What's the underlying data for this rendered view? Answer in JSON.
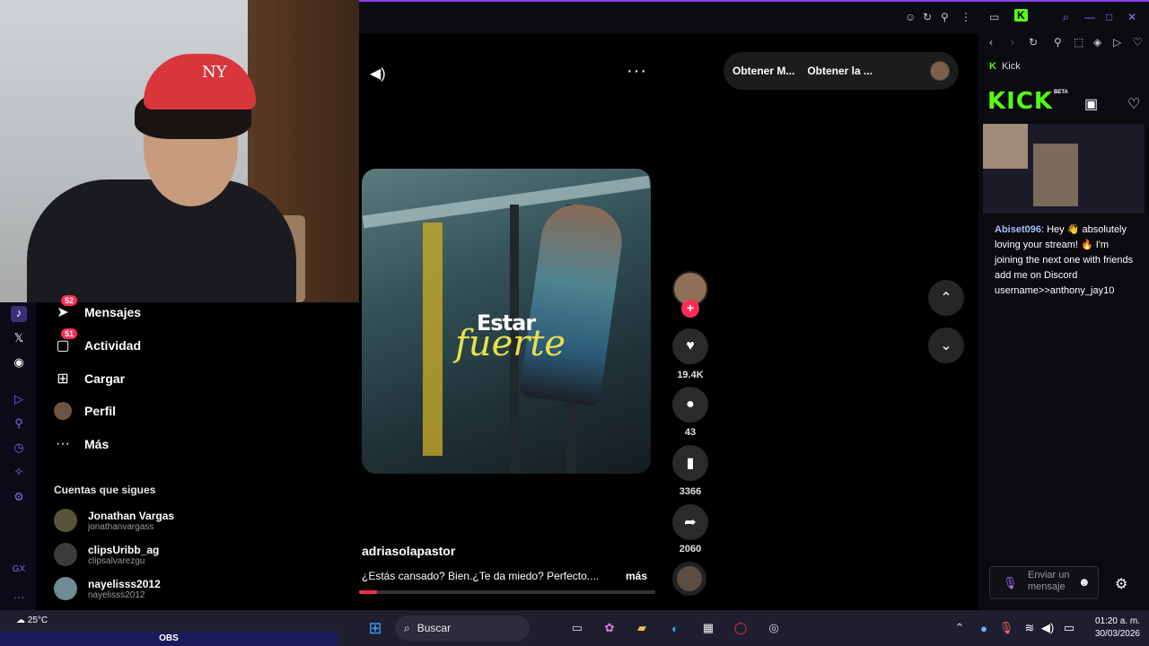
{
  "webcam": {
    "cap_logo": "NY"
  },
  "sidebar": {
    "items": [
      {
        "label": "Mensajes",
        "badge": "52",
        "icon": "send-icon"
      },
      {
        "label": "Actividad",
        "badge": "51",
        "icon": "activity-icon"
      },
      {
        "label": "Cargar",
        "badge": "",
        "icon": "upload-icon"
      },
      {
        "label": "Perfil",
        "badge": "",
        "icon": "profile-avatar"
      },
      {
        "label": "Más",
        "badge": "",
        "icon": "more-icon"
      }
    ],
    "following_title": "Cuentas que sigues",
    "following": [
      {
        "name": "Jonathan Vargas",
        "handle": "jonathanvargass"
      },
      {
        "name": "clipsUribb_ag",
        "handle": "clipsalvarezgu"
      },
      {
        "name": "nayelisss2012",
        "handle": "nayelisss2012"
      }
    ]
  },
  "main": {
    "pill": {
      "btn1": "Obtener M...",
      "btn2": "Obtener la ..."
    },
    "video": {
      "overlay_line1": "Estar",
      "overlay_line2": "fuerte",
      "progress": 0.06
    },
    "actions": {
      "likes": "19.4K",
      "comments": "43",
      "saves": "3366",
      "shares": "2060"
    },
    "username": "adriasolapastor",
    "caption": "¿Estás cansado? Bien.¿Te da miedo? Perfecto....",
    "more_label": "más"
  },
  "kick": {
    "tab_title": "Kick",
    "logo": "KICK",
    "beta": "BETA",
    "chat": {
      "user": "Abiset096",
      "message": ": Hey 👋 absolutely loving your stream! 🔥 I'm joining the next one with friends add me on Discord username>>anthony_jay10"
    },
    "input_placeholder": "Enviar un mensaje"
  },
  "taskbar": {
    "weather": "25°C",
    "obs": "OBS",
    "search": "Buscar",
    "time": "01:20 a. m.",
    "date": "30/03/2026"
  },
  "colors": {
    "tiktok_red": "#fe2c55",
    "kick_green": "#53fc18",
    "accent_purple": "#8a3df2"
  }
}
